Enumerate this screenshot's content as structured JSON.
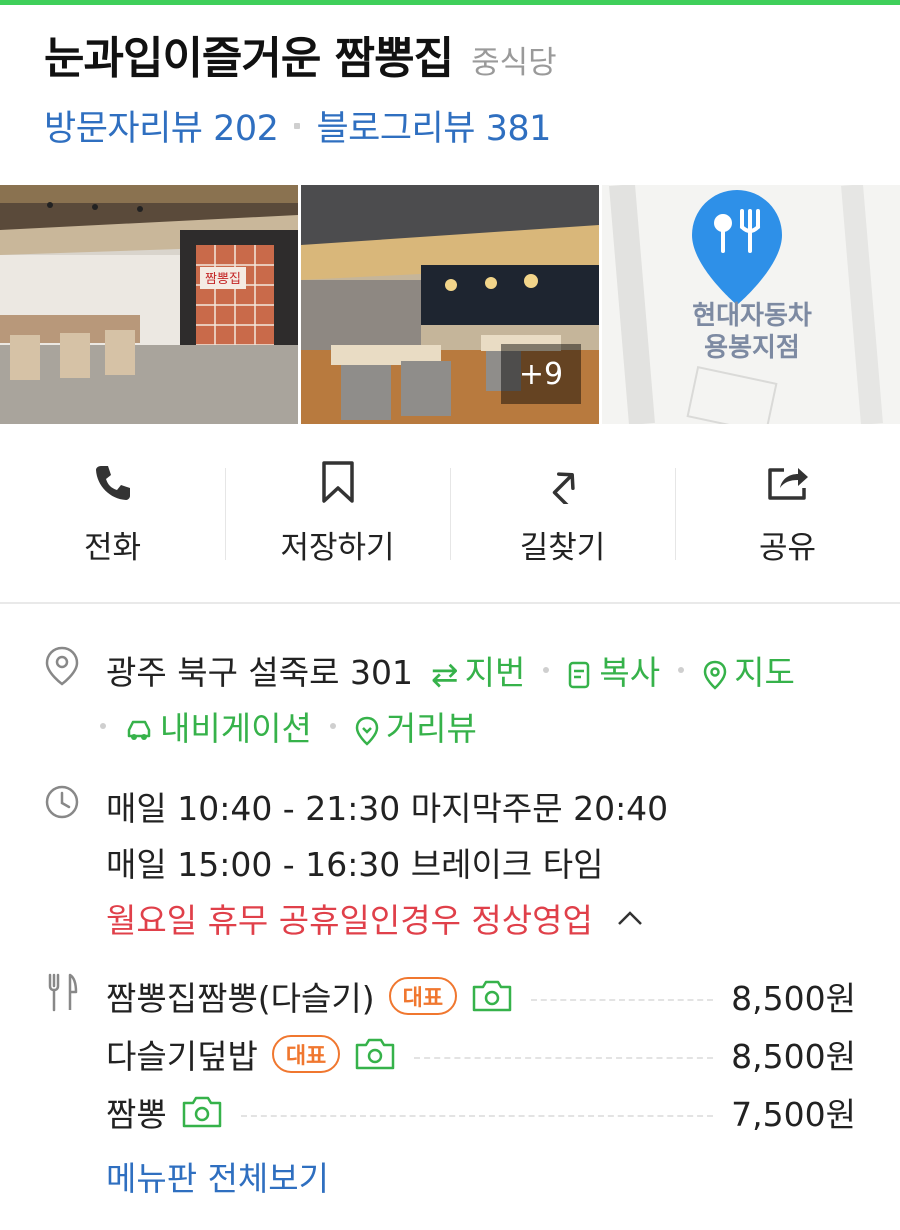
{
  "place": {
    "name": "눈과입이즐거운 짬뽕집",
    "category": "중식당"
  },
  "reviews": {
    "visitor_label": "방문자리뷰 202",
    "blog_label": "블로그리뷰 381"
  },
  "photos": {
    "more_count": "+9",
    "map_label_line1": "현대자동차",
    "map_label_line2": "용봉지점",
    "sign_text": "짬뽕집"
  },
  "actions": [
    {
      "label": "전화",
      "icon": "phone-icon"
    },
    {
      "label": "저장하기",
      "icon": "bookmark-icon"
    },
    {
      "label": "길찾기",
      "icon": "directions-icon"
    },
    {
      "label": "공유",
      "icon": "share-icon"
    }
  ],
  "address": {
    "text": "광주 북구 설죽로 301",
    "jibun": "지번",
    "copy": "복사",
    "map": "지도",
    "navigation": "내비게이션",
    "street_view": "거리뷰"
  },
  "hours": {
    "line1": "매일 10:40 - 21:30 마지막주문 20:40",
    "line2": "매일 15:00 - 16:30 브레이크 타임",
    "notice": "월요일 휴무 공휴일인경우 정상영업"
  },
  "menu": {
    "items": [
      {
        "name": "짬뽕집짬뽕(다슬기)",
        "badge": "대표",
        "price": "8,500원"
      },
      {
        "name": "다슬기덮밥",
        "badge": "대표",
        "price": "8,500원"
      },
      {
        "name": "짬뽕",
        "badge": "",
        "price": "7,500원"
      }
    ],
    "view_all": "메뉴판 전체보기"
  },
  "colors": {
    "accent_green": "#36b24a",
    "link_blue": "#2f6fc0",
    "notice_red": "#e0404a",
    "badge_orange": "#f0772f"
  }
}
